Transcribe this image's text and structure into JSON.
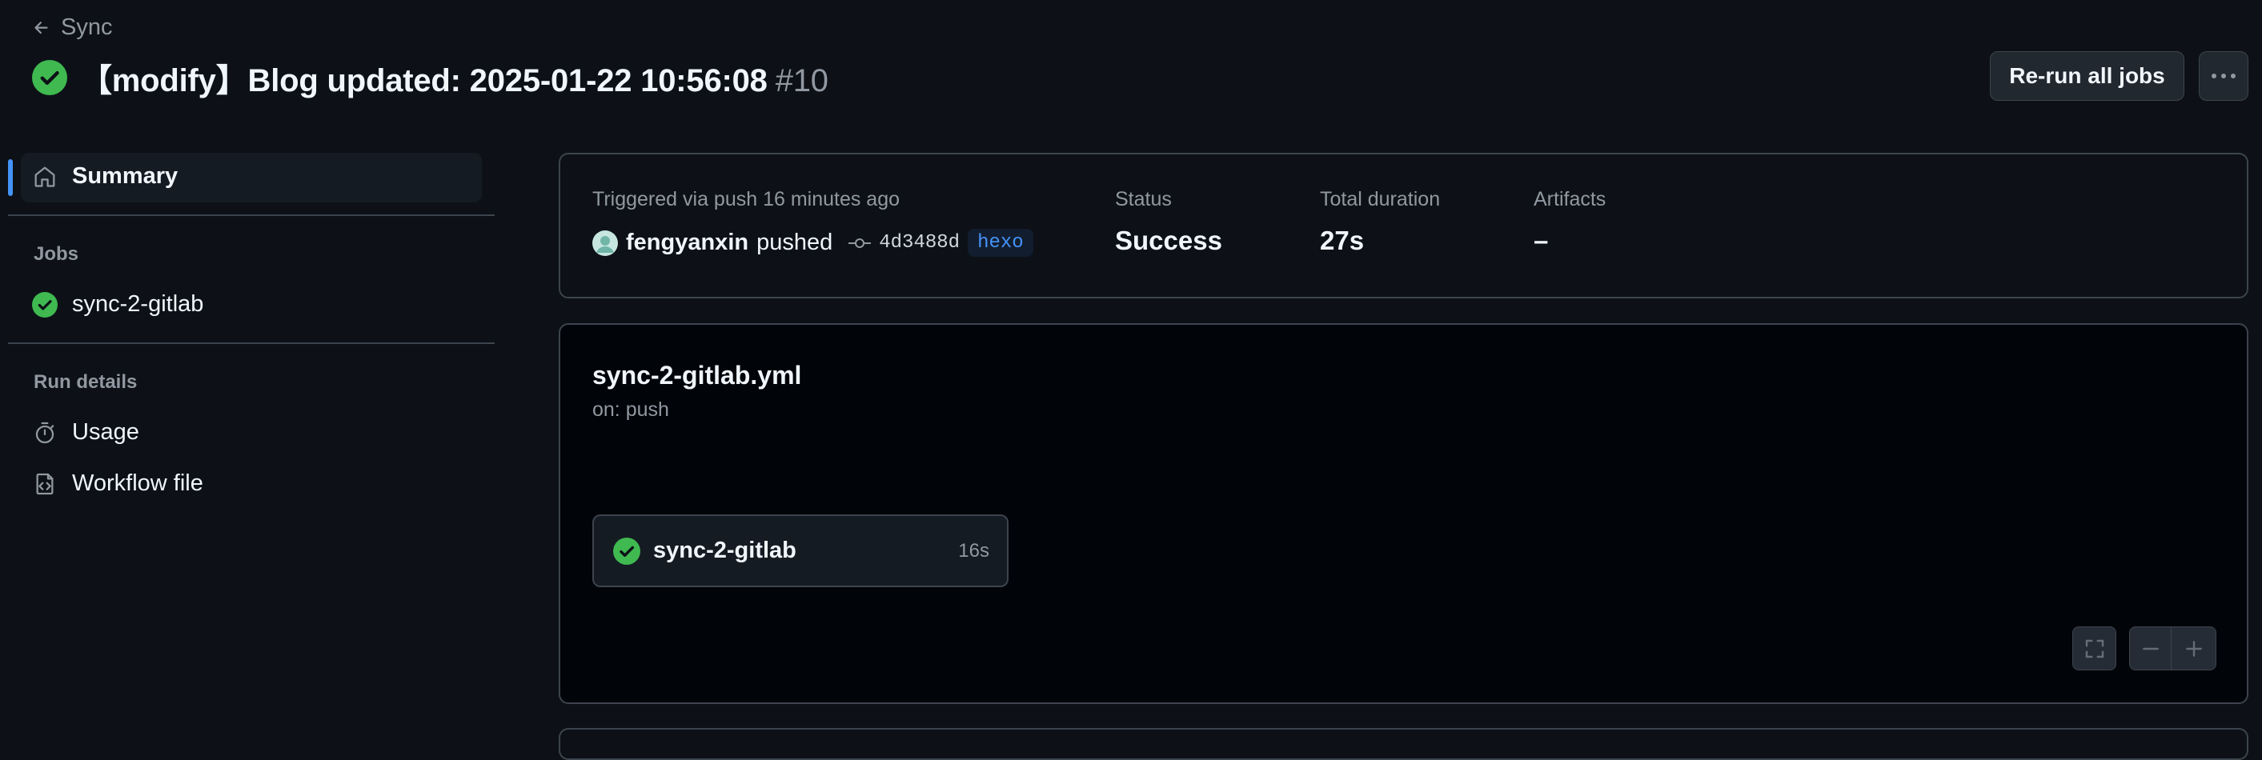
{
  "header": {
    "back_label": "Sync",
    "title": "【modify】Blog updated: 2025-01-22 10:56:08",
    "run_number": "#10",
    "rerun_label": "Re-run all jobs"
  },
  "sidebar": {
    "summary_label": "Summary",
    "jobs_heading": "Jobs",
    "jobs": [
      {
        "label": "sync-2-gitlab"
      }
    ],
    "run_details_heading": "Run details",
    "usage_label": "Usage",
    "workflow_file_label": "Workflow file"
  },
  "summary": {
    "trigger_text": "Triggered via push 16 minutes ago",
    "actor": "fengyanxin",
    "action": "pushed",
    "commit_sha": "4d3488d",
    "branch": "hexo",
    "status_label": "Status",
    "status_value": "Success",
    "duration_label": "Total duration",
    "duration_value": "27s",
    "artifacts_label": "Artifacts",
    "artifacts_value": "–"
  },
  "workflow": {
    "filename": "sync-2-gitlab.yml",
    "trigger": "on: push",
    "job": {
      "name": "sync-2-gitlab",
      "duration": "16s"
    }
  },
  "colors": {
    "success": "#3fb950",
    "accent": "#4493f8",
    "background": "#0d1117"
  }
}
